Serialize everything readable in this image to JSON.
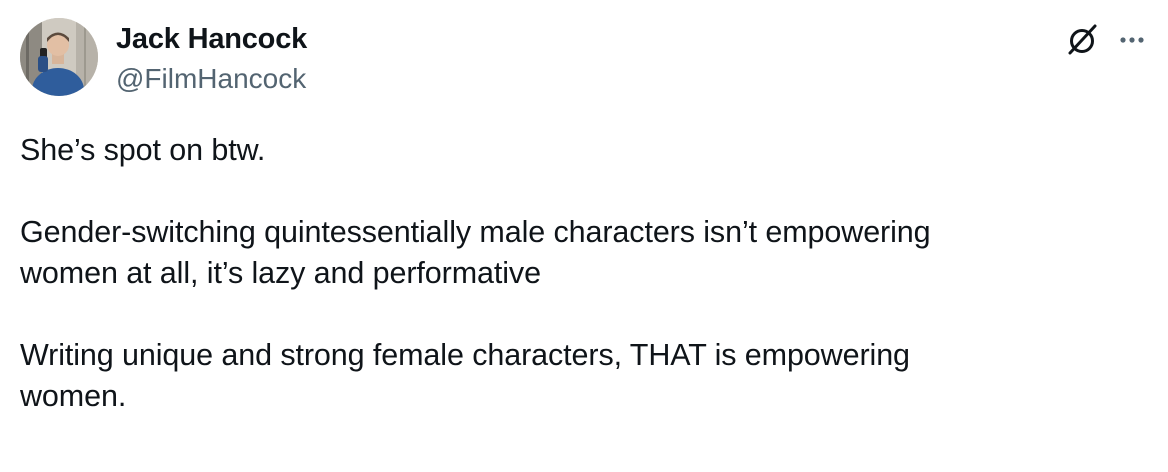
{
  "author": {
    "display_name": "Jack Hancock",
    "handle": "@FilmHancock",
    "avatar_icon": "profile-photo"
  },
  "actions": {
    "grok_icon": "grok-icon",
    "more_icon": "more-icon"
  },
  "tweet": {
    "paragraphs": [
      "She’s spot on btw.",
      "Gender-switching quintessentially male characters isn’t empowering\nwomen at all, it’s lazy and performative",
      "Writing unique and strong female characters, THAT is empowering\nwomen."
    ]
  },
  "colors": {
    "text": "#0f1419",
    "secondary_text": "#536471",
    "background": "#ffffff"
  }
}
